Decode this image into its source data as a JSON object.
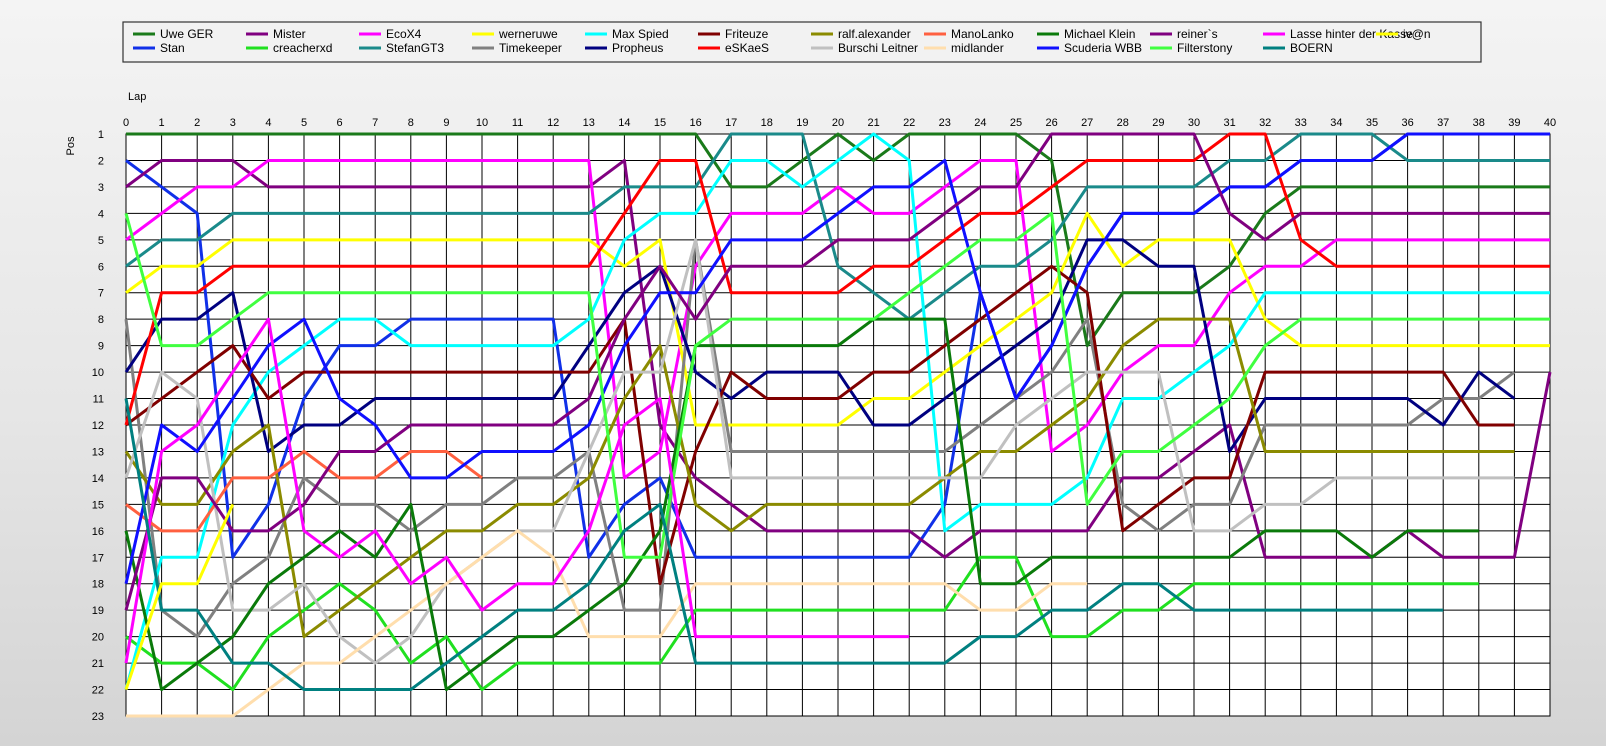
{
  "chart_data": {
    "type": "line",
    "xlabel": "Lap",
    "ylabel": "Pos",
    "xlim": [
      0,
      40
    ],
    "ylim": [
      1,
      23
    ],
    "y_inverted": true,
    "grid": true,
    "legend_position": "top",
    "x_ticks": [
      0,
      1,
      2,
      3,
      4,
      5,
      6,
      7,
      8,
      9,
      10,
      11,
      12,
      13,
      14,
      15,
      16,
      17,
      18,
      19,
      20,
      21,
      22,
      23,
      24,
      25,
      26,
      27,
      28,
      29,
      30,
      31,
      32,
      33,
      34,
      35,
      36,
      37,
      38,
      39,
      40
    ],
    "y_ticks": [
      1,
      2,
      3,
      4,
      5,
      6,
      7,
      8,
      9,
      10,
      11,
      12,
      13,
      14,
      15,
      16,
      17,
      18,
      19,
      20,
      21,
      22,
      23
    ],
    "series": [
      {
        "name": "Uwe GER",
        "color": "#1a7a1a",
        "values": [
          1,
          1,
          1,
          1,
          1,
          1,
          1,
          1,
          1,
          1,
          1,
          1,
          1,
          1,
          1,
          1,
          1,
          3,
          3,
          2,
          1,
          2,
          1,
          1,
          1,
          1,
          2,
          9,
          7,
          7,
          7,
          6,
          4,
          3,
          3,
          3,
          3,
          3,
          3,
          3,
          3
        ]
      },
      {
        "name": "Stan",
        "color": "#1030e8",
        "values": [
          2,
          3,
          4,
          17,
          15,
          11,
          9,
          9,
          8,
          8,
          8,
          8,
          8,
          17,
          15,
          14,
          17,
          17,
          17,
          17,
          17,
          17,
          17,
          15,
          7,
          11,
          9,
          6,
          4,
          4,
          4,
          3,
          3,
          2,
          2,
          2,
          1,
          1,
          1,
          1,
          1
        ]
      },
      {
        "name": "Mister",
        "color": "#800080",
        "values": [
          3,
          2,
          2,
          2,
          3,
          3,
          3,
          3,
          3,
          3,
          3,
          3,
          3,
          3,
          2,
          12,
          14,
          15,
          16,
          16,
          16,
          16,
          16,
          17,
          16,
          16,
          16,
          16,
          14,
          14,
          13,
          12,
          17,
          17,
          17,
          17,
          16,
          17,
          17,
          17,
          10
        ]
      },
      {
        "name": "creacherxd",
        "color": "#20e020",
        "values": [
          20,
          21,
          21,
          22,
          20,
          19,
          18,
          19,
          21,
          20,
          22,
          21,
          21,
          21,
          21,
          21,
          19,
          19,
          19,
          19,
          19,
          19,
          19,
          19,
          17,
          17,
          20,
          20,
          19,
          19,
          18,
          18,
          18,
          18,
          18,
          18,
          18,
          18,
          18
        ]
      },
      {
        "name": "EcoX4",
        "color": "#ff00ff",
        "values": [
          5,
          4,
          3,
          3,
          2,
          2,
          2,
          2,
          2,
          2,
          2,
          2,
          2,
          2,
          14,
          13,
          6,
          4,
          4,
          4,
          3,
          4,
          4,
          3,
          2,
          2,
          13,
          12,
          10,
          9,
          9,
          7,
          6,
          6,
          5,
          5,
          5,
          5,
          5,
          5,
          5
        ]
      },
      {
        "name": "StefanGT3",
        "color": "#1a8a8a",
        "values": [
          6,
          5,
          5,
          4,
          4,
          4,
          4,
          4,
          4,
          4,
          4,
          4,
          4,
          4,
          3,
          3,
          3,
          1,
          1,
          1,
          6,
          7,
          8,
          7,
          6,
          6,
          5,
          3,
          3,
          3,
          3,
          2,
          2,
          1,
          1,
          1,
          2,
          2,
          2,
          2,
          2
        ]
      },
      {
        "name": "werneruwe",
        "color": "#ffff00",
        "values": [
          7,
          6,
          6,
          5,
          5,
          5,
          5,
          5,
          5,
          5,
          5,
          5,
          5,
          5,
          6,
          5,
          12,
          12,
          12,
          12,
          12,
          11,
          11,
          10,
          9,
          8,
          7,
          4,
          6,
          5,
          5,
          5,
          8,
          9,
          9,
          9,
          9,
          9,
          9,
          9,
          9
        ]
      },
      {
        "name": "Timekeeper",
        "color": "#808080",
        "values": [
          8,
          19,
          20,
          18,
          17,
          14,
          15,
          15,
          16,
          15,
          15,
          14,
          14,
          13,
          19,
          19,
          5,
          13,
          13,
          13,
          13,
          13,
          13,
          13,
          12,
          11,
          10,
          8,
          15,
          16,
          15,
          15,
          12,
          12,
          12,
          12,
          12,
          11,
          11,
          10
        ]
      },
      {
        "name": "Max Spied",
        "color": "#00ffff",
        "values": [
          22,
          17,
          17,
          12,
          10,
          9,
          8,
          8,
          9,
          9,
          9,
          9,
          9,
          8,
          5,
          4,
          4,
          2,
          2,
          3,
          2,
          1,
          2,
          16,
          15,
          15,
          15,
          14,
          11,
          11,
          10,
          9,
          7,
          7,
          7,
          7,
          7,
          7,
          7,
          7,
          7
        ]
      },
      {
        "name": "Propheus",
        "color": "#000080",
        "values": [
          10,
          8,
          8,
          7,
          13,
          12,
          12,
          11,
          11,
          11,
          11,
          11,
          11,
          9,
          7,
          6,
          10,
          11,
          10,
          10,
          10,
          12,
          12,
          11,
          10,
          9,
          8,
          5,
          5,
          6,
          6,
          13,
          11,
          11,
          11,
          11,
          11,
          12,
          10,
          11
        ]
      },
      {
        "name": "Friteuze",
        "color": "#800000",
        "values": [
          12,
          11,
          10,
          9,
          11,
          10,
          10,
          10,
          10,
          10,
          10,
          10,
          10,
          10,
          8,
          18,
          13,
          10,
          11,
          11,
          11,
          10,
          10,
          9,
          8,
          7,
          6,
          7,
          16,
          15,
          14,
          14,
          10,
          10,
          10,
          10,
          10,
          10,
          12,
          12
        ]
      },
      {
        "name": "eSKaeS",
        "color": "#ff0000",
        "values": [
          12,
          7,
          7,
          6,
          6,
          6,
          6,
          6,
          6,
          6,
          6,
          6,
          6,
          6,
          4,
          2,
          2,
          7,
          7,
          7,
          7,
          6,
          6,
          5,
          4,
          4,
          3,
          2,
          2,
          2,
          2,
          1,
          1,
          5,
          6,
          6,
          6,
          6,
          6,
          6,
          6
        ]
      },
      {
        "name": "ralf.alexander",
        "color": "#8b8b00",
        "values": [
          13,
          15,
          15,
          13,
          12,
          20,
          19,
          18,
          17,
          16,
          16,
          15,
          15,
          14,
          11,
          9,
          15,
          16,
          15,
          15,
          15,
          15,
          15,
          14,
          13,
          13,
          12,
          11,
          9,
          8,
          8,
          8,
          13,
          13,
          13,
          13,
          13,
          13,
          13,
          13
        ]
      },
      {
        "name": "Burschi Leitner",
        "color": "#c0c0c0",
        "values": [
          14,
          10,
          11,
          19,
          19,
          18,
          20,
          21,
          20,
          18,
          17,
          16,
          16,
          13,
          10,
          10,
          5,
          14,
          14,
          14,
          14,
          14,
          14,
          14,
          14,
          12,
          11,
          10,
          10,
          10,
          16,
          16,
          15,
          15,
          14,
          14,
          14,
          14,
          14,
          14
        ]
      },
      {
        "name": "ManoLanko",
        "color": "#ff6040",
        "values": [
          15,
          16,
          16,
          14,
          14,
          13,
          14,
          14,
          13,
          13,
          14
        ]
      },
      {
        "name": "midlander",
        "color": "#ffdead",
        "values": [
          23,
          23,
          23,
          23,
          22,
          21,
          21,
          20,
          19,
          18,
          17,
          16,
          17,
          20,
          20,
          20,
          18,
          18,
          18,
          18,
          18,
          18,
          18,
          18,
          19,
          19,
          18,
          18
        ]
      },
      {
        "name": "Michael Klein",
        "color": "#0a7a0a",
        "values": [
          16,
          22,
          21,
          20,
          18,
          17,
          16,
          17,
          15,
          22,
          21,
          20,
          20,
          19,
          18,
          16,
          9,
          9,
          9,
          9,
          9,
          8,
          8,
          8,
          18,
          18,
          17,
          17,
          17,
          17,
          17,
          17,
          16,
          16,
          16,
          17,
          16,
          16,
          16
        ]
      },
      {
        "name": "Scuderia WBB",
        "color": "#1010ff",
        "values": [
          18,
          12,
          13,
          11,
          9,
          8,
          11,
          12,
          14,
          14,
          13,
          13,
          13,
          12,
          9,
          7,
          7,
          5,
          5,
          5,
          4,
          3,
          3,
          2,
          7,
          11,
          9,
          6,
          4,
          4,
          4,
          3,
          3,
          2,
          2,
          2,
          1,
          1,
          1,
          1,
          1
        ]
      },
      {
        "name": "reiner`s",
        "color": "#800080",
        "values": [
          19,
          14,
          14,
          16,
          16,
          15,
          13,
          13,
          12,
          12,
          12,
          12,
          12,
          11,
          8,
          6,
          8,
          6,
          6,
          6,
          5,
          5,
          5,
          4,
          3,
          3,
          1,
          1,
          1,
          1,
          1,
          4,
          5,
          4,
          4,
          4,
          4,
          4,
          4,
          4,
          4
        ]
      },
      {
        "name": "Filterstony",
        "color": "#40ff40",
        "values": [
          4,
          9,
          9,
          8,
          7,
          7,
          7,
          7,
          7,
          7,
          7,
          7,
          7,
          7,
          17,
          17,
          9,
          8,
          8,
          8,
          8,
          8,
          7,
          6,
          5,
          5,
          4,
          15,
          13,
          13,
          12,
          11,
          9,
          8,
          8,
          8,
          8,
          8,
          8,
          8,
          8
        ]
      },
      {
        "name": "Lasse hinter der Kasse",
        "color": "#ff00ff",
        "values": [
          21,
          13,
          12,
          10,
          8,
          16,
          17,
          16,
          18,
          17,
          19,
          18,
          18,
          16,
          12,
          11,
          20,
          20,
          20,
          20,
          20,
          20,
          20
        ]
      },
      {
        "name": "BOERN",
        "color": "#008080",
        "values": [
          11,
          19,
          19,
          21,
          21,
          22,
          22,
          22,
          22,
          21,
          20,
          19,
          19,
          18,
          16,
          15,
          21,
          21,
          21,
          21,
          21,
          21,
          21,
          21,
          20,
          20,
          19,
          19,
          18,
          18,
          19,
          19,
          19,
          19,
          19,
          19,
          19,
          19
        ]
      },
      {
        "name": "iv@n",
        "color": "#ffff00",
        "values": [
          22,
          18,
          18,
          15
        ]
      }
    ]
  }
}
